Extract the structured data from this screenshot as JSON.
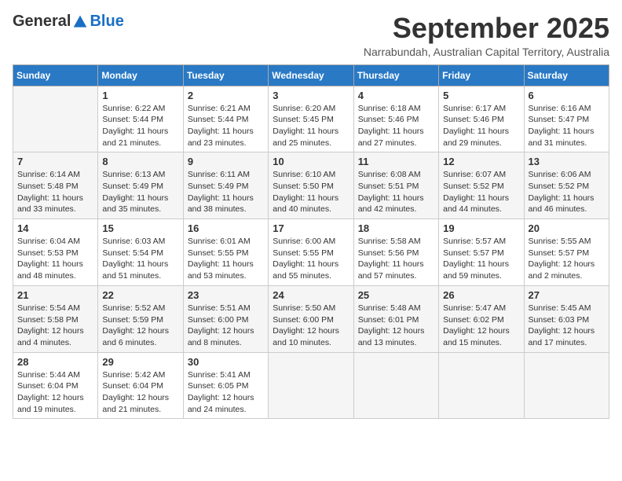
{
  "header": {
    "logo_general": "General",
    "logo_blue": "Blue",
    "month": "September 2025",
    "location": "Narrabundah, Australian Capital Territory, Australia"
  },
  "weekdays": [
    "Sunday",
    "Monday",
    "Tuesday",
    "Wednesday",
    "Thursday",
    "Friday",
    "Saturday"
  ],
  "weeks": [
    [
      {
        "day": "",
        "empty": true
      },
      {
        "day": "1",
        "sunrise": "6:22 AM",
        "sunset": "5:44 PM",
        "daylight": "11 hours and 21 minutes."
      },
      {
        "day": "2",
        "sunrise": "6:21 AM",
        "sunset": "5:44 PM",
        "daylight": "11 hours and 23 minutes."
      },
      {
        "day": "3",
        "sunrise": "6:20 AM",
        "sunset": "5:45 PM",
        "daylight": "11 hours and 25 minutes."
      },
      {
        "day": "4",
        "sunrise": "6:18 AM",
        "sunset": "5:46 PM",
        "daylight": "11 hours and 27 minutes."
      },
      {
        "day": "5",
        "sunrise": "6:17 AM",
        "sunset": "5:46 PM",
        "daylight": "11 hours and 29 minutes."
      },
      {
        "day": "6",
        "sunrise": "6:16 AM",
        "sunset": "5:47 PM",
        "daylight": "11 hours and 31 minutes."
      }
    ],
    [
      {
        "day": "7",
        "sunrise": "6:14 AM",
        "sunset": "5:48 PM",
        "daylight": "11 hours and 33 minutes."
      },
      {
        "day": "8",
        "sunrise": "6:13 AM",
        "sunset": "5:49 PM",
        "daylight": "11 hours and 35 minutes."
      },
      {
        "day": "9",
        "sunrise": "6:11 AM",
        "sunset": "5:49 PM",
        "daylight": "11 hours and 38 minutes."
      },
      {
        "day": "10",
        "sunrise": "6:10 AM",
        "sunset": "5:50 PM",
        "daylight": "11 hours and 40 minutes."
      },
      {
        "day": "11",
        "sunrise": "6:08 AM",
        "sunset": "5:51 PM",
        "daylight": "11 hours and 42 minutes."
      },
      {
        "day": "12",
        "sunrise": "6:07 AM",
        "sunset": "5:52 PM",
        "daylight": "11 hours and 44 minutes."
      },
      {
        "day": "13",
        "sunrise": "6:06 AM",
        "sunset": "5:52 PM",
        "daylight": "11 hours and 46 minutes."
      }
    ],
    [
      {
        "day": "14",
        "sunrise": "6:04 AM",
        "sunset": "5:53 PM",
        "daylight": "11 hours and 48 minutes."
      },
      {
        "day": "15",
        "sunrise": "6:03 AM",
        "sunset": "5:54 PM",
        "daylight": "11 hours and 51 minutes."
      },
      {
        "day": "16",
        "sunrise": "6:01 AM",
        "sunset": "5:55 PM",
        "daylight": "11 hours and 53 minutes."
      },
      {
        "day": "17",
        "sunrise": "6:00 AM",
        "sunset": "5:55 PM",
        "daylight": "11 hours and 55 minutes."
      },
      {
        "day": "18",
        "sunrise": "5:58 AM",
        "sunset": "5:56 PM",
        "daylight": "11 hours and 57 minutes."
      },
      {
        "day": "19",
        "sunrise": "5:57 AM",
        "sunset": "5:57 PM",
        "daylight": "11 hours and 59 minutes."
      },
      {
        "day": "20",
        "sunrise": "5:55 AM",
        "sunset": "5:57 PM",
        "daylight": "12 hours and 2 minutes."
      }
    ],
    [
      {
        "day": "21",
        "sunrise": "5:54 AM",
        "sunset": "5:58 PM",
        "daylight": "12 hours and 4 minutes."
      },
      {
        "day": "22",
        "sunrise": "5:52 AM",
        "sunset": "5:59 PM",
        "daylight": "12 hours and 6 minutes."
      },
      {
        "day": "23",
        "sunrise": "5:51 AM",
        "sunset": "6:00 PM",
        "daylight": "12 hours and 8 minutes."
      },
      {
        "day": "24",
        "sunrise": "5:50 AM",
        "sunset": "6:00 PM",
        "daylight": "12 hours and 10 minutes."
      },
      {
        "day": "25",
        "sunrise": "5:48 AM",
        "sunset": "6:01 PM",
        "daylight": "12 hours and 13 minutes."
      },
      {
        "day": "26",
        "sunrise": "5:47 AM",
        "sunset": "6:02 PM",
        "daylight": "12 hours and 15 minutes."
      },
      {
        "day": "27",
        "sunrise": "5:45 AM",
        "sunset": "6:03 PM",
        "daylight": "12 hours and 17 minutes."
      }
    ],
    [
      {
        "day": "28",
        "sunrise": "5:44 AM",
        "sunset": "6:04 PM",
        "daylight": "12 hours and 19 minutes."
      },
      {
        "day": "29",
        "sunrise": "5:42 AM",
        "sunset": "6:04 PM",
        "daylight": "12 hours and 21 minutes."
      },
      {
        "day": "30",
        "sunrise": "5:41 AM",
        "sunset": "6:05 PM",
        "daylight": "12 hours and 24 minutes."
      },
      {
        "day": "",
        "empty": true
      },
      {
        "day": "",
        "empty": true
      },
      {
        "day": "",
        "empty": true
      },
      {
        "day": "",
        "empty": true
      }
    ]
  ]
}
